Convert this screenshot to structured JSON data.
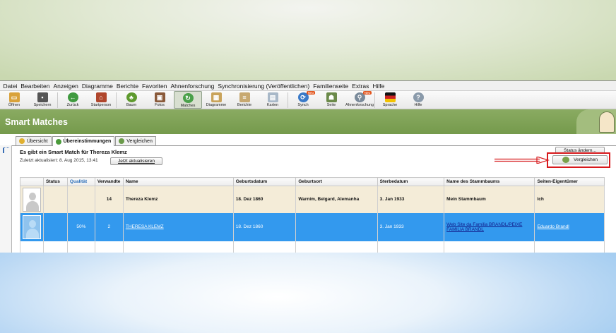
{
  "menu": [
    "Datei",
    "Bearbeiten",
    "Anzeigen",
    "Diagramme",
    "Berichte",
    "Favoriten",
    "Ahnenforschung",
    "Synchronisierung (Veröffentlichen)",
    "Familienseite",
    "Extras",
    "Hilfe"
  ],
  "toolbar": [
    {
      "label": "Öffnen",
      "icon": "folder-icon",
      "color": "#d9a23a"
    },
    {
      "label": "Speichern",
      "icon": "save-icon",
      "color": "#555555"
    },
    {
      "label": "Zurück",
      "icon": "back-arrow-icon",
      "color": "#3f9a3f"
    },
    {
      "label": "Startperson",
      "icon": "home-icon",
      "color": "#b0462c"
    },
    {
      "label": "Baum",
      "icon": "tree-icon",
      "color": "#5e9a2e"
    },
    {
      "label": "Fotos",
      "icon": "photos-icon",
      "color": "#8a5a3a"
    },
    {
      "label": "Matches",
      "icon": "matches-icon",
      "color": "#4aa04a"
    },
    {
      "label": "Diagramme",
      "icon": "diagram-icon",
      "color": "#c9a35a"
    },
    {
      "label": "Berichte",
      "icon": "report-icon",
      "color": "#c7a870"
    },
    {
      "label": "Karten",
      "icon": "map-icon",
      "color": "#a8b8c8"
    },
    {
      "label": "Synch",
      "icon": "sync-icon",
      "color": "#3a7ac8",
      "badge": "Neu"
    },
    {
      "label": "Seite",
      "icon": "page-icon",
      "color": "#6b8a4a"
    },
    {
      "label": "Ahnenforschung",
      "icon": "research-icon",
      "color": "#7a8a9a",
      "badge": "Neu"
    },
    {
      "label": "Sprache",
      "icon": "flag-icon",
      "color": "#cc2222"
    },
    {
      "label": "Hilfe",
      "icon": "help-icon",
      "color": "#8a9aaa"
    }
  ],
  "banner": {
    "title": "Smart Matches"
  },
  "tabs": [
    {
      "label": "Übersicht",
      "icon": "overview-icon"
    },
    {
      "label": "Übereinstimmungen",
      "icon": "matches-tab-icon"
    },
    {
      "label": "Vergleichen",
      "icon": "compare-tab-icon"
    }
  ],
  "content": {
    "heading": "Es gibt ein Smart Match für Thereza Klemz",
    "updated": "Zuletzt aktualisiert: 8. Aug 2015, 13:41",
    "refresh_label": "Jetzt aktualisieren",
    "status_label": "Status ändern...",
    "compare_label": "Vergleichen"
  },
  "table": {
    "headers": [
      "",
      "Status",
      "Qualität",
      "Verwandte",
      "Name",
      "Geburtsdatum",
      "Geburtsort",
      "Sterbedatum",
      "Name des Stammbaums",
      "Seiten-Eigentümer"
    ],
    "rows": [
      {
        "status": "",
        "quality": "",
        "relatives": "14",
        "name": "Thereza Klemz",
        "birth_date": "18. Dez 1860",
        "birth_place": "Warnim, Belgard, Alemanha",
        "death_date": "3. Jan 1933",
        "tree": "Mein Stammbaum",
        "owner": "Ich"
      },
      {
        "status": "",
        "quality": "50%",
        "relatives": "2",
        "name": "THERESA KLEMZ",
        "birth_date": "18. Dez 1860",
        "birth_place": "",
        "death_date": "3. Jan 1933",
        "tree": "Web Site da Familia BRANDL/PEIXE FAMILIA BRANDL",
        "owner": "Eduardo Brandl"
      }
    ]
  },
  "colors": {
    "banner": "#7fa355",
    "selected_row": "#3399ee",
    "highlight": "#d7191c"
  }
}
